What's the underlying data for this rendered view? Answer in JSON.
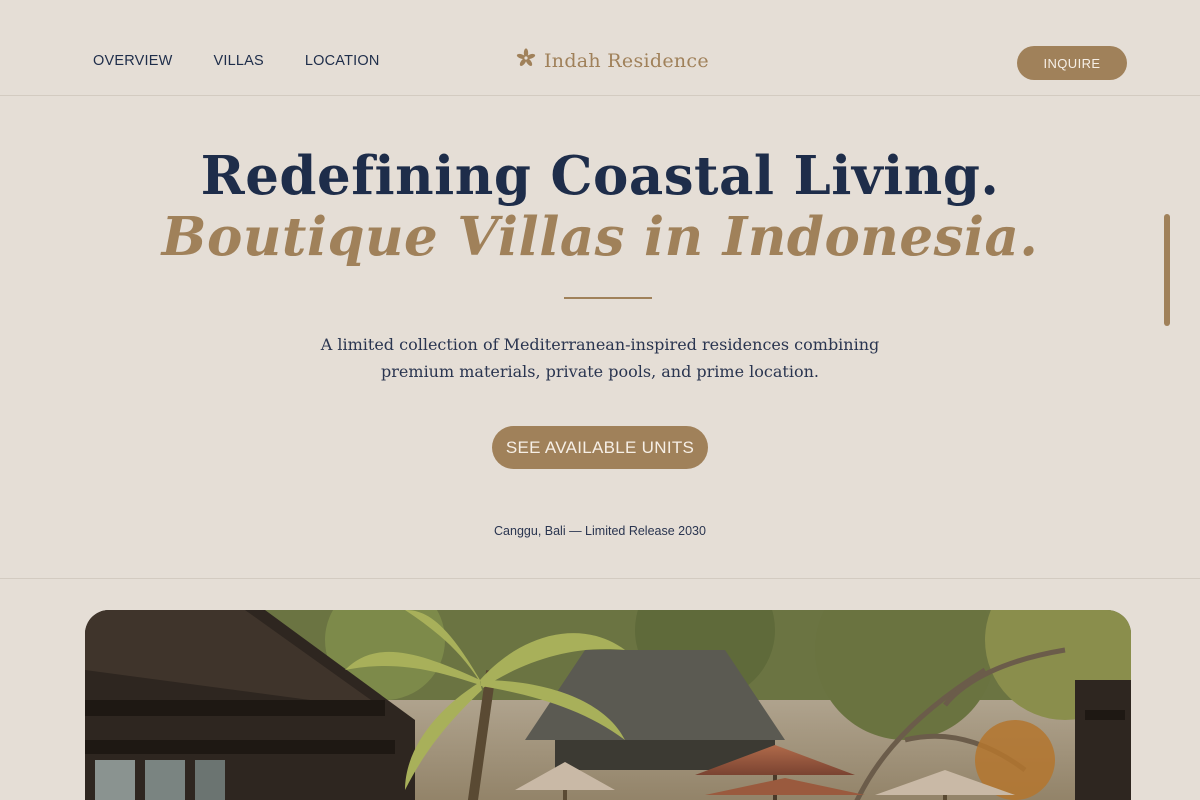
{
  "nav": {
    "items": [
      {
        "label": "OVERVIEW"
      },
      {
        "label": "VILLAS"
      },
      {
        "label": "LOCATION"
      }
    ]
  },
  "brand": {
    "name": "Indah Residence",
    "icon": "flower-icon"
  },
  "header": {
    "inquire_label": "INQUIRE"
  },
  "hero": {
    "headline": "Redefining Coastal Living.",
    "subheadline": "Boutique Villas in Indonesia.",
    "intro_line1": "A limited collection of Mediterranean-inspired residences combining",
    "intro_line2": "premium materials, private pools, and prime location.",
    "cta_label": "SEE AVAILABLE UNITS",
    "location_note": "Canggu, Bali — Limited Release 2030"
  },
  "colors": {
    "background": "#e5ded6",
    "accent": "#a0815a",
    "navy": "#1e2d4a"
  }
}
